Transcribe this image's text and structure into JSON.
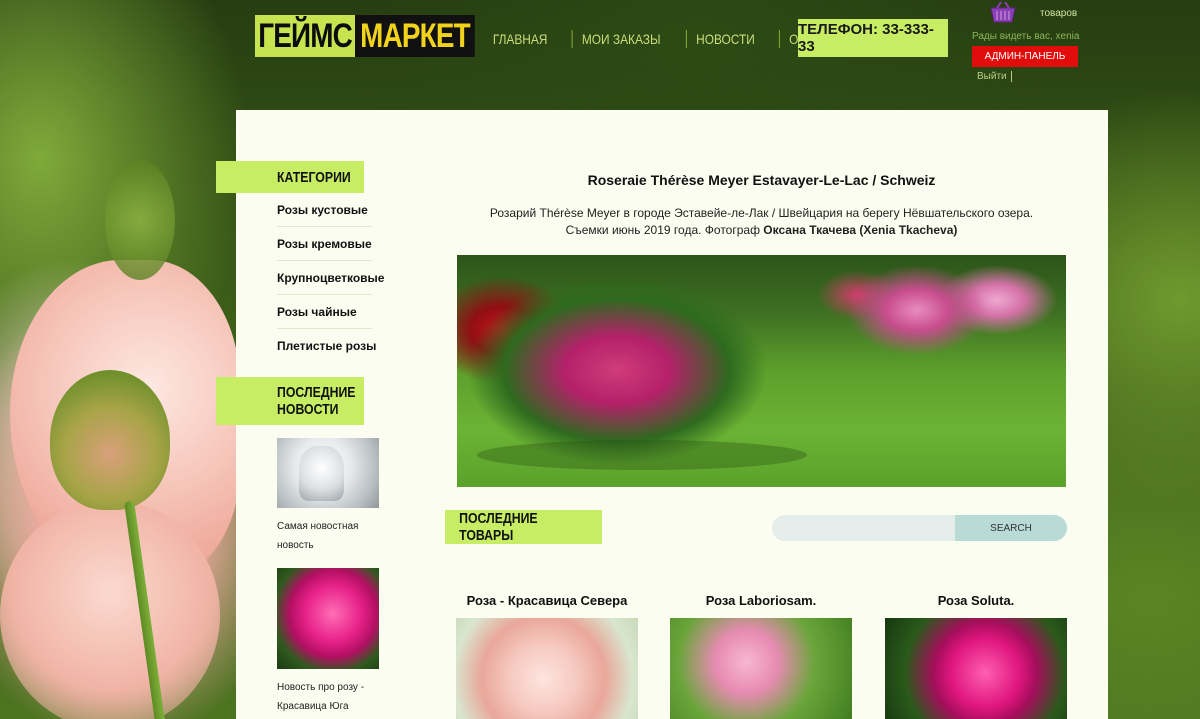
{
  "header": {
    "logo_part1": "ГЕЙМС",
    "logo_part2": "МАРКЕТ",
    "nav": [
      "ГЛАВНАЯ",
      "МОИ ЗАКАЗЫ",
      "НОВОСТИ",
      "О РОЗАРИИ"
    ],
    "phone": "ТЕЛЕФОН: 33-333-33",
    "cart_text": "товаров",
    "user_line": "Рады видеть вас, xenia",
    "admin_button": "АДМИН-ПАНЕЛЬ",
    "logout": "Выйти"
  },
  "sidebar": {
    "categories_title": "КАТЕГОРИИ",
    "categories": [
      "Розы кустовые",
      "Розы кремовые",
      "Крупноцветковые",
      "Розы чайные",
      "Плетистые розы"
    ],
    "news_title": "ПОСЛЕДНИЕ\nНОВОСТИ",
    "news": [
      {
        "caption": "Самая новостная новость"
      },
      {
        "caption": "Новость про розу - Красавица Юга"
      }
    ]
  },
  "article": {
    "title": "Roseraie Thérèse Meyer Estavayer-Le-Lac / Schweiz",
    "desc_line1": "Розарий Thérèse Meyer в городе Эставейе-ле-Лак / Швейцария на берегу Нёвшательского озера.",
    "desc_line2_prefix": "Съемки июнь 2019 года. Фотограф ",
    "desc_photographer": "Оксана Ткачева (Xenia Tkacheva)"
  },
  "products": {
    "title": "ПОСЛЕДНИЕ ТОВАРЫ",
    "search_placeholder": "",
    "search_button": "SEARCH",
    "items": [
      {
        "title": "Роза - Красавица Севера"
      },
      {
        "title": "Роза Laboriosam."
      },
      {
        "title": "Роза Soluta."
      }
    ]
  },
  "colors": {
    "accent": "#c6ed63",
    "admin_button": "#e10d0d",
    "panel": "#fbfdf0"
  }
}
